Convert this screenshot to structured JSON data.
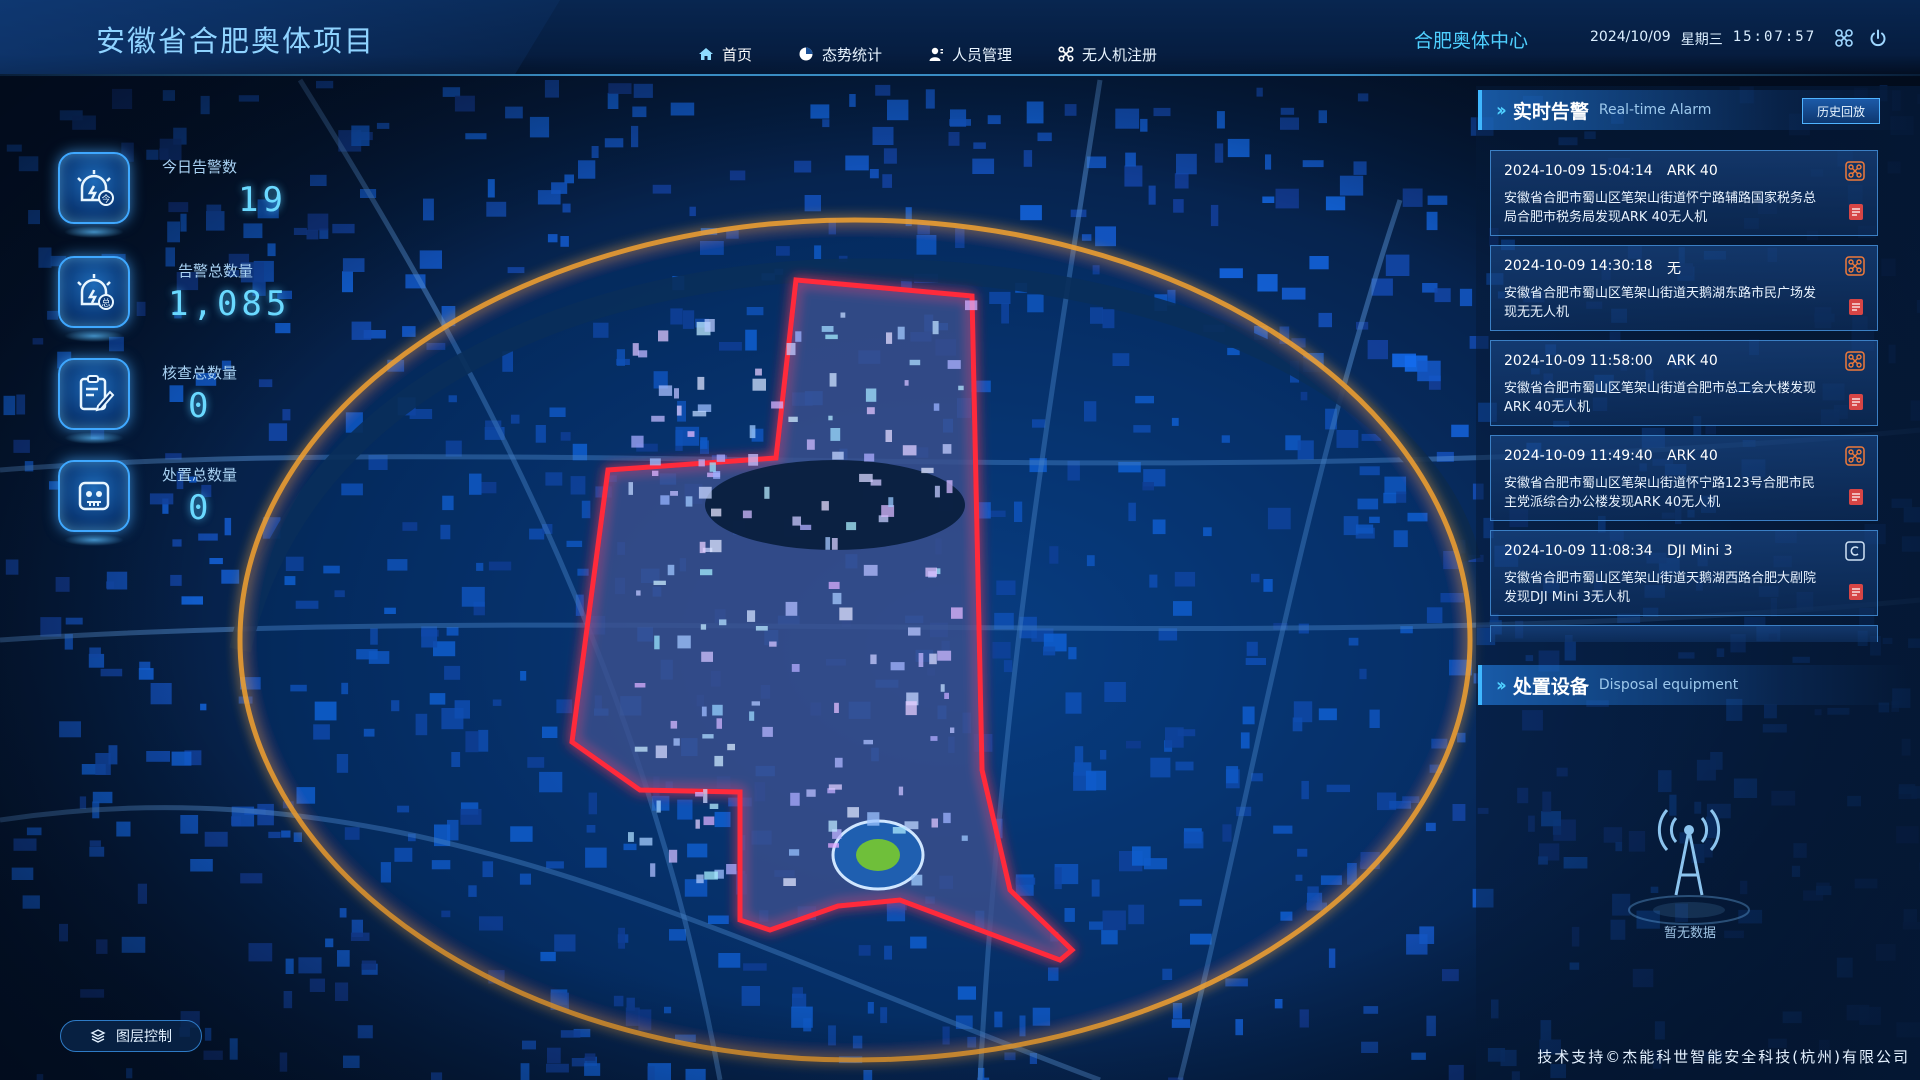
{
  "header": {
    "title": "安徽省合肥奥体项目",
    "venue": "合肥奥体中心",
    "date": "2024/10/09",
    "weekday": "星期三",
    "time": "15:07:57",
    "tabs": [
      {
        "label": "首页",
        "icon": "home-icon",
        "active": true
      },
      {
        "label": "态势统计",
        "icon": "pie-chart-icon",
        "active": false
      },
      {
        "label": "人员管理",
        "icon": "user-icon",
        "active": false
      },
      {
        "label": "无人机注册",
        "icon": "drone-icon",
        "active": false
      }
    ]
  },
  "stats": [
    {
      "label": "今日告警数",
      "value": "19",
      "icon": "alarm-today-icon"
    },
    {
      "label": "告警总数量",
      "value": "1,085",
      "icon": "alarm-total-icon"
    },
    {
      "label": "核查总数量",
      "value": "0",
      "icon": "checklist-icon"
    },
    {
      "label": "处置总数量",
      "value": "0",
      "icon": "disposal-icon"
    }
  ],
  "layer_control": {
    "label": "图层控制",
    "icon": "layers-icon"
  },
  "realtime_alarm": {
    "title_zh": "实时告警",
    "title_en": "Real-time Alarm",
    "history_button": "历史回放",
    "items": [
      {
        "time": "2024-10-09 15:04:14",
        "model": "ARK 40",
        "desc": "安徽省合肥市蜀山区笔架山街道怀宁路辅路国家税务总局合肥市税务局发现ARK 40无人机",
        "status_color": "#f07a3a"
      },
      {
        "time": "2024-10-09 14:30:18",
        "model": "无",
        "desc": "安徽省合肥市蜀山区笔架山街道天鹅湖东路市民广场发现无无人机",
        "status_color": "#f07a3a"
      },
      {
        "time": "2024-10-09 11:58:00",
        "model": "ARK 40",
        "desc": "安徽省合肥市蜀山区笔架山街道合肥市总工会大楼发现ARK 40无人机",
        "status_color": "#f07a3a"
      },
      {
        "time": "2024-10-09 11:49:40",
        "model": "ARK 40",
        "desc": "安徽省合肥市蜀山区笔架山街道怀宁路123号合肥市民主党派综合办公楼发现ARK 40无人机",
        "status_color": "#f07a3a"
      },
      {
        "time": "2024-10-09 11:08:34",
        "model": "DJI Mini 3",
        "desc": "安徽省合肥市蜀山区笔架山街道天鹅湖西路合肥大剧院发现DJI Mini 3无人机",
        "status_color": "#cfe2f5"
      }
    ]
  },
  "disposal": {
    "title_zh": "处置设备",
    "title_en": "Disposal equipment",
    "empty_text": "暂无数据"
  },
  "footer": "技术支持©杰能科世智能安全科技(杭州)有限公司",
  "colors": {
    "accent": "#4fd0ff",
    "alert": "#ff2a3a",
    "ring": "#f0a030"
  }
}
